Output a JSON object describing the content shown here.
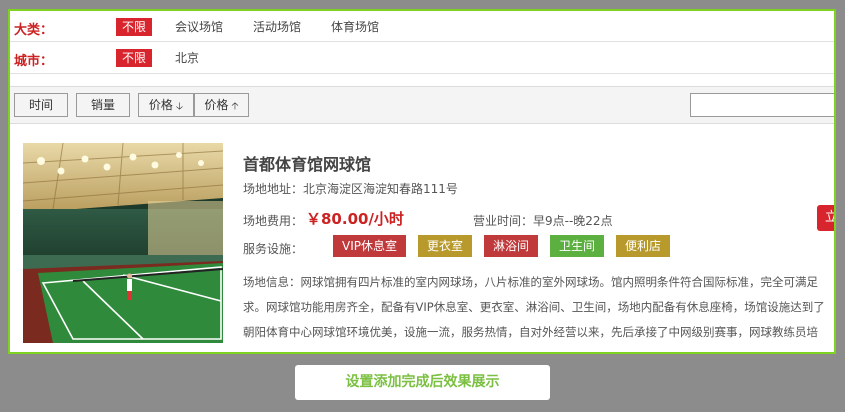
{
  "filters": {
    "category": {
      "label": "大类：",
      "options": [
        "不限",
        "会议场馆",
        "活动场馆",
        "体育场馆"
      ]
    },
    "city": {
      "label": "城市：",
      "options": [
        "不限",
        "北京"
      ]
    }
  },
  "sortbar": {
    "time": "时间",
    "sales": "销量",
    "price_desc": "价格",
    "price_asc": "价格",
    "search_value": ""
  },
  "venue": {
    "title": "首都体育馆网球馆",
    "address": "场地地址：北京海淀区海淀知春路111号",
    "fee_label": "场地费用：",
    "price": "￥80.00/小时",
    "hours_label": "营业时间：",
    "hours": "早9点--晚22点",
    "book": "立即",
    "services_label": "服务设施：",
    "services": [
      {
        "name": "VIP休息室",
        "color": "#c0393b"
      },
      {
        "name": "更衣室",
        "color": "#b89a2c"
      },
      {
        "name": "淋浴间",
        "color": "#c0393b"
      },
      {
        "name": "卫生间",
        "color": "#5cb040"
      },
      {
        "name": "便利店",
        "color": "#b89a2c"
      }
    ],
    "info_lines": [
      "场地信息：网球馆拥有四片标准的室内网球场，八片标准的室外网球场。馆内照明条件符合国际标准，完全可满足",
      "求。网球馆功能用房齐全，配备有VIP休息室、更衣室、淋浴间、卫生间，场地内配备有休息座椅，场馆设施达到了",
      "朝阳体育中心网球馆环境优美，设施一流，服务热情，自对外经营以来，先后承接了中网级别赛事，网球教练员培"
    ]
  },
  "caption": "设置添加完成后效果展示"
}
